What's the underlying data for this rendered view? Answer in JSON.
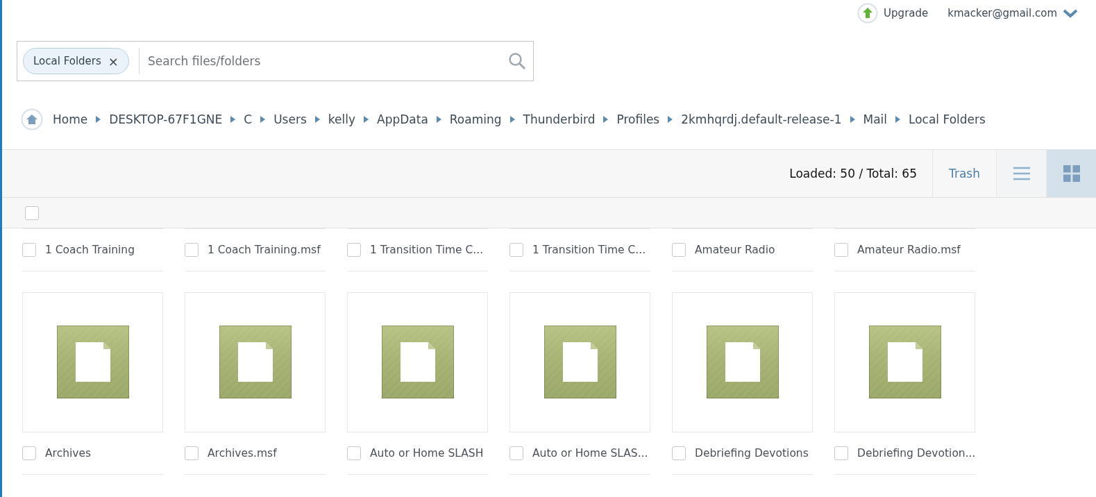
{
  "top_bar": {
    "upgrade": "Upgrade",
    "account": "kmacker@gmail.com"
  },
  "search": {
    "filter_chip": "Local Folders",
    "chip_close": "×",
    "placeholder": "Search files/folders"
  },
  "breadcrumb": [
    "Home",
    "DESKTOP-67F1GNE",
    "C",
    "Users",
    "kelly",
    "AppData",
    "Roaming",
    "Thunderbird",
    "Profiles",
    "2kmhqrdj.default-release-1",
    "Mail",
    "Local Folders"
  ],
  "toolbar": {
    "count": "Loaded: 50 / Total: 65",
    "trash": "Trash",
    "views": [
      {
        "kind": "list",
        "selected": false
      },
      {
        "kind": "grid",
        "selected": true
      }
    ]
  },
  "select_all": {
    "checked": false
  },
  "rows": [
    {
      "kind": "scrolled",
      "items": [
        {
          "name": "1 Coach Training",
          "checked": false
        },
        {
          "name": "1 Coach Training.msf",
          "checked": false
        },
        {
          "name": "1 Transition Time C...",
          "checked": false
        },
        {
          "name": "1 Transition Time C...",
          "checked": false
        },
        {
          "name": "Amateur Radio",
          "checked": false
        },
        {
          "name": "Amateur Radio.msf",
          "checked": false
        }
      ]
    },
    {
      "kind": "full",
      "items": [
        {
          "name": "Archives",
          "checked": false
        },
        {
          "name": "Archives.msf",
          "checked": false
        },
        {
          "name": "Auto or Home SLASH",
          "checked": false
        },
        {
          "name": "Auto or Home SLAS...",
          "checked": false
        },
        {
          "name": "Debriefing Devotions",
          "checked": false
        },
        {
          "name": "Debriefing Devotion...",
          "checked": false
        }
      ]
    }
  ]
}
